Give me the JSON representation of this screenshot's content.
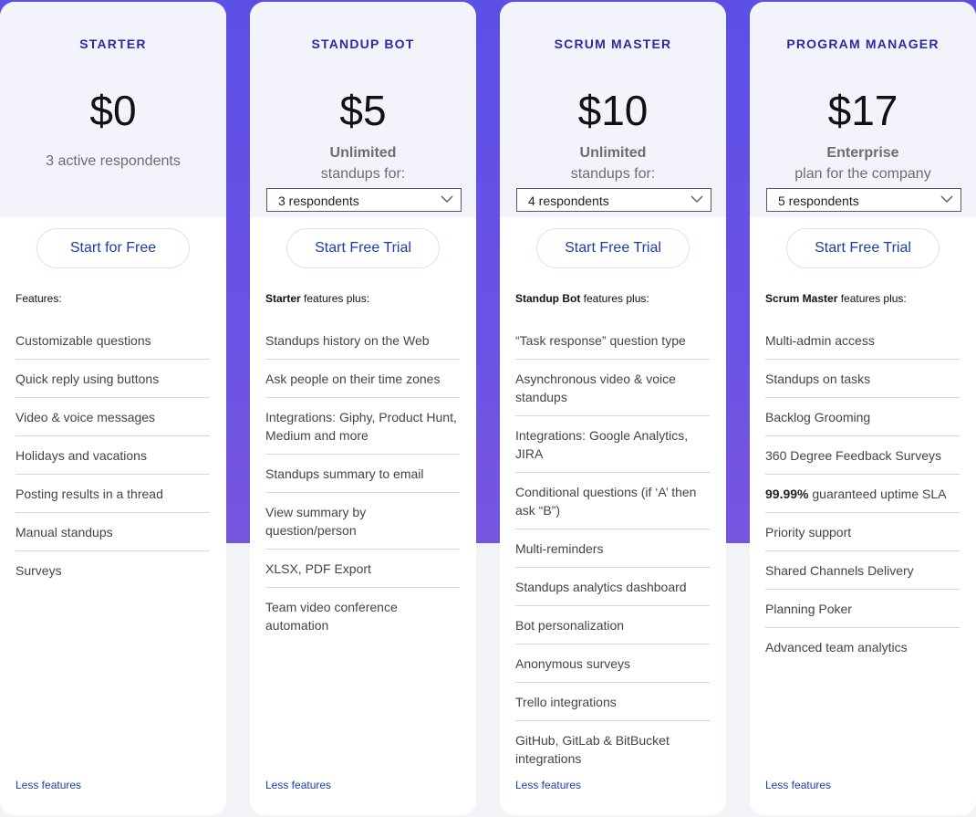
{
  "plans": [
    {
      "name": "STARTER",
      "price": "$0",
      "sub_text": "3 active respondents",
      "cta": "Start for Free",
      "features_heading": "Features:",
      "features": [
        "Customizable questions",
        "Quick reply using buttons",
        "Video & voice messages",
        "Holidays and vacations",
        "Posting results in a thread",
        "Manual standups",
        "Surveys"
      ],
      "less_link": "Less features"
    },
    {
      "name": "STANDUP BOT",
      "price": "$5",
      "sub_bold": "Unlimited",
      "sub_line2": "standups for:",
      "select_value": "3 respondents",
      "cta": "Start Free Trial",
      "features_heading_bold": "Starter",
      "features_heading_rest": " features plus:",
      "features": [
        "Standups history on the Web",
        "Ask people on their time zones",
        "Integrations: Giphy, Product Hunt, Medium and more",
        "Standups summary to email",
        "View summary by question/person",
        "XLSX, PDF Export",
        "Team video conference automation"
      ],
      "less_link": "Less features"
    },
    {
      "name": "SCRUM MASTER",
      "price": "$10",
      "sub_bold": "Unlimited",
      "sub_line2": "standups for:",
      "select_value": "4 respondents",
      "cta": "Start Free Trial",
      "features_heading_bold": "Standup Bot",
      "features_heading_rest": " features plus:",
      "features": [
        "“Task response” question type",
        "Asynchronous video & voice standups",
        "Integrations: Google Analytics, JIRA",
        "Conditional questions (if ‘A’ then ask “B”)",
        "Multi-reminders",
        "Standups analytics dashboard",
        "Bot personalization",
        "Anonymous surveys",
        "Trello integrations",
        "GitHub, GitLab & BitBucket integrations"
      ],
      "less_link": "Less features"
    },
    {
      "name": "PROGRAM MANAGER",
      "price": "$17",
      "sub_bold": "Enterprise",
      "sub_line2": "plan for the company",
      "select_value": "5 respondents",
      "cta": "Start Free Trial",
      "features_heading_bold": "Scrum Master",
      "features_heading_rest": " features plus:",
      "features": [
        "Multi-admin access",
        "Standups on tasks",
        "Backlog Grooming",
        "360 Degree Feedback Surveys",
        "guaranteed uptime SLA",
        "Priority support",
        "Shared Channels Delivery",
        "Planning Poker",
        "Advanced team analytics"
      ],
      "uptime_bold": "99.99%",
      "less_link": "Less features"
    }
  ],
  "colors": {
    "accent_purple": "#5b4fe6",
    "plan_name": "#2a2aa6",
    "link_blue": "#1a3fa8",
    "card_top_bg": "#f3f4fb"
  },
  "icons": {
    "dropdown": "chevron-down-icon"
  }
}
